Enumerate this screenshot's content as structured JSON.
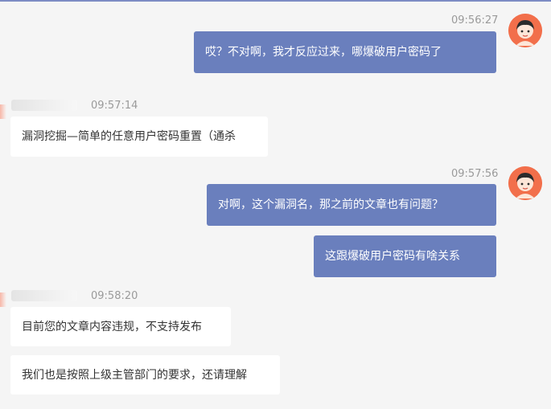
{
  "messages": [
    {
      "time": "09:56:27",
      "text": "哎？不对啊，我才反应过来，哪爆破用户密码了"
    },
    {
      "time": "09:57:14",
      "text": "漏洞挖掘—简单的任意用户密码重置（通杀"
    },
    {
      "time": "09:57:56",
      "text": "对啊，这个漏洞名，那之前的文章也有问题？"
    },
    {
      "text": "这跟爆破用户密码有啥关系"
    },
    {
      "time": "09:58:20",
      "text": "目前您的文章内容违规，不支持发布"
    },
    {
      "text": "我们也是按照上级主管部门的要求，还请理解"
    }
  ],
  "colors": {
    "outgoing_bubble": "#6a7fbd",
    "incoming_bubble": "#ffffff",
    "avatar_bg": "#f26f4b",
    "background": "#f5f5f5"
  },
  "icons": [
    "user-avatar-icon",
    "blurred-avatar"
  ]
}
